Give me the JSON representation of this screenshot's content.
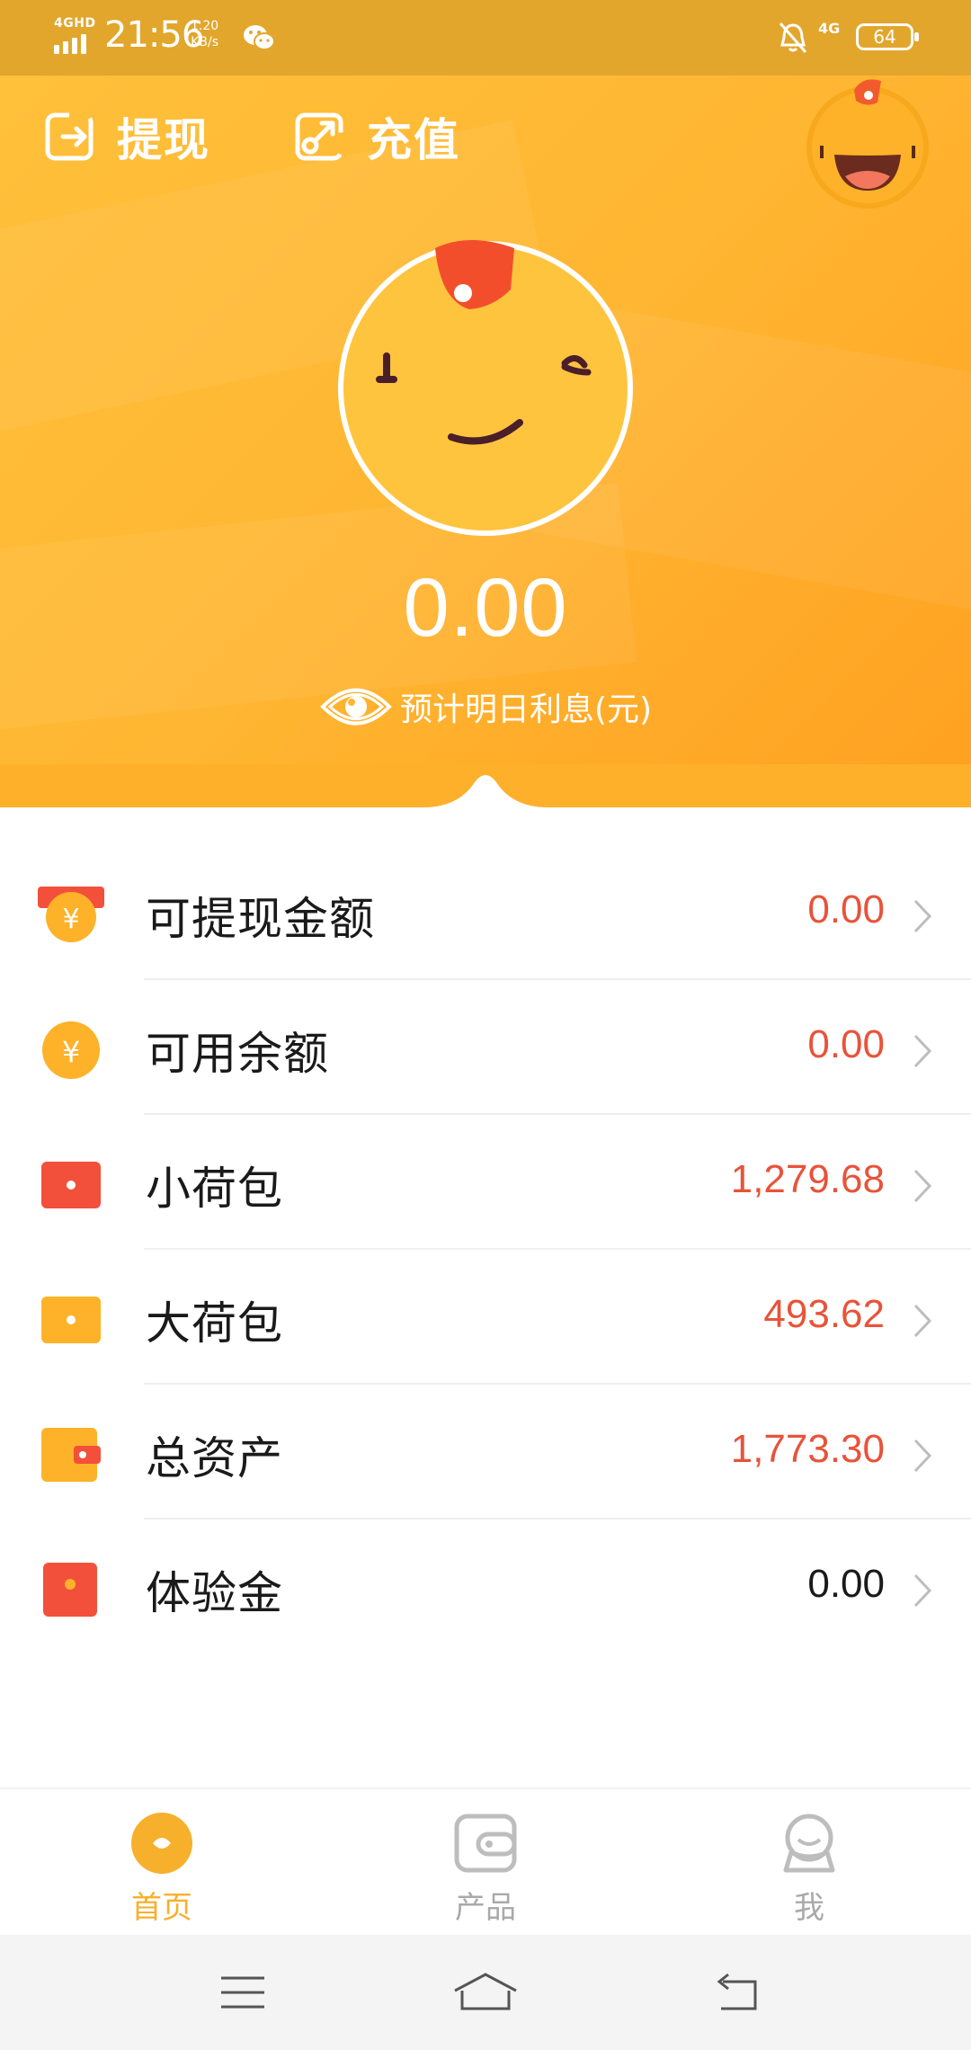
{
  "status_bar": {
    "network": "4GHD",
    "time": "21:56",
    "speed_value": "1.20",
    "speed_unit": "KB/s",
    "network_right": "4G",
    "battery": "64"
  },
  "header": {
    "withdraw_label": "提现",
    "recharge_label": "充值",
    "interest_value": "0.00",
    "interest_label": "预计明日利息(元)",
    "bg_color": "#FFB632"
  },
  "list": {
    "items": [
      {
        "label": "可提现金额",
        "value": "0.00",
        "icon": "yuan-coin-card-icon"
      },
      {
        "label": "可用余额",
        "value": "0.00",
        "icon": "yuan-coin-icon"
      },
      {
        "label": "小荷包",
        "value": "1,279.68",
        "icon": "red-envelope-icon"
      },
      {
        "label": "大荷包",
        "value": "493.62",
        "icon": "yellow-envelope-icon"
      },
      {
        "label": "总资产",
        "value": "1,773.30",
        "icon": "wallet-icon"
      },
      {
        "label": "体验金",
        "value": "0.00",
        "icon": "red-packet-icon"
      }
    ],
    "value_color": "#E8533A"
  },
  "tabbar": {
    "tabs": [
      {
        "label": "首页",
        "icon": "home-icon",
        "active": true
      },
      {
        "label": "产品",
        "icon": "product-icon",
        "active": false
      },
      {
        "label": "我",
        "icon": "profile-icon",
        "active": false
      }
    ],
    "active_color": "#F7B02B"
  },
  "system_nav": {
    "buttons": [
      "menu-icon",
      "home-nav-icon",
      "back-icon"
    ]
  }
}
